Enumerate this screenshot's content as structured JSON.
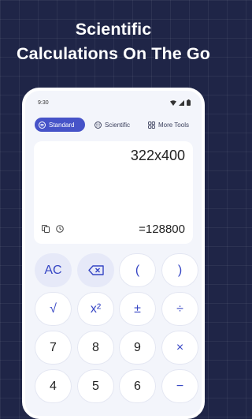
{
  "headline": {
    "line1": "Scientific",
    "line2": "Calculations On The Go"
  },
  "status_bar": {
    "time": "9:30",
    "icons": [
      "wifi-icon",
      "signal-icon",
      "battery-icon"
    ]
  },
  "tabs": [
    {
      "label": "Standard",
      "icon": "standard-icon",
      "active": true
    },
    {
      "label": "Scientific",
      "icon": "scientific-icon",
      "active": false
    },
    {
      "label": "More Tools",
      "icon": "grid-icon",
      "active": false
    }
  ],
  "display": {
    "expression": "322x400",
    "result": "=128800",
    "icons": [
      "copy-icon",
      "history-icon"
    ]
  },
  "keypad": {
    "rows": [
      [
        "AC",
        "⌫",
        "(",
        ")"
      ],
      [
        "√",
        "x²",
        "±",
        "÷"
      ],
      [
        "7",
        "8",
        "9",
        "×"
      ],
      [
        "4",
        "5",
        "6",
        "−"
      ]
    ]
  },
  "colors": {
    "background": "#1f2547",
    "accent": "#4653c8",
    "key_text_accent": "#3545c4",
    "phone_background": "#f3f5fb"
  }
}
